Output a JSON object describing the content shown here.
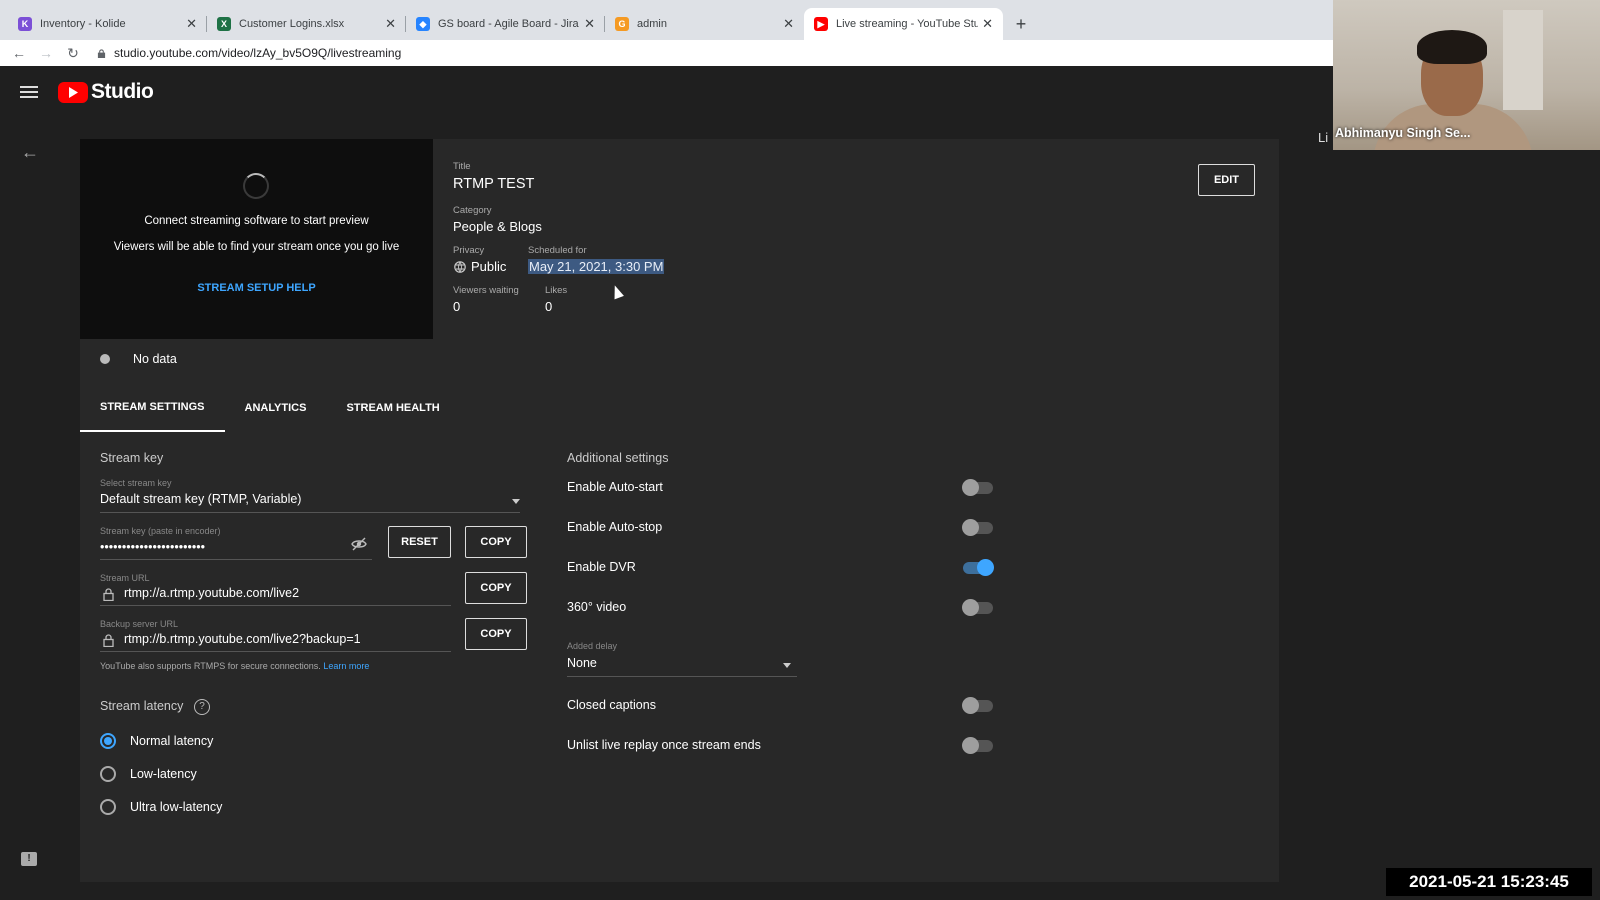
{
  "browser": {
    "tabs": [
      {
        "title": "Inventory - Kolide",
        "icon": "kolide-icon",
        "icon_color": "#7b4fd6",
        "glyph": "K"
      },
      {
        "title": "Customer Logins.xlsx",
        "icon": "excel-icon",
        "icon_color": "#1e7145",
        "glyph": "X"
      },
      {
        "title": "GS board - Agile Board - Jira",
        "icon": "jira-icon",
        "icon_color": "#2684ff",
        "glyph": "◆"
      },
      {
        "title": "admin",
        "icon": "grafana-icon",
        "icon_color": "#f59a23",
        "glyph": "G"
      },
      {
        "title": "Live streaming - YouTube Stud",
        "icon": "youtube-icon",
        "icon_color": "#ff0000",
        "glyph": "▶"
      }
    ],
    "url": "studio.youtube.com/video/lzAy_bv5O9Q/livestreaming"
  },
  "app": {
    "name": "Studio",
    "accent": "#3ea6ff",
    "brand_red": "#ff0000"
  },
  "preview": {
    "line1": "Connect streaming software to start preview",
    "line2": "Viewers will be able to find your stream once you go live",
    "help_link": "STREAM SETUP HELP"
  },
  "details": {
    "title_label": "Title",
    "title": "RTMP TEST",
    "category_label": "Category",
    "category": "People & Blogs",
    "privacy_label": "Privacy",
    "privacy": "Public",
    "scheduled_label": "Scheduled for",
    "scheduled": "May 21, 2021, 3:30 PM",
    "viewers_label": "Viewers waiting",
    "viewers": "0",
    "likes_label": "Likes",
    "likes": "0",
    "edit": "EDIT",
    "status": "No data"
  },
  "settings_tabs": [
    "STREAM SETTINGS",
    "ANALYTICS",
    "STREAM HEALTH"
  ],
  "stream": {
    "section": "Stream key",
    "select_label": "Select stream key",
    "select_value": "Default stream key (RTMP, Variable)",
    "key_label": "Stream key (paste in encoder)",
    "key_value": "••••••••••••••••••••••••",
    "reset": "RESET",
    "copy": "COPY",
    "url_label": "Stream URL",
    "url_value": "rtmp://a.rtmp.youtube.com/live2",
    "backup_label": "Backup server URL",
    "backup_value": "rtmp://b.rtmp.youtube.com/live2?backup=1",
    "note": "YouTube also supports RTMPS for secure connections.",
    "learn_more": "Learn more",
    "latency_title": "Stream latency",
    "latency_options": [
      "Normal latency",
      "Low-latency",
      "Ultra low-latency"
    ],
    "latency_selected": "Normal latency"
  },
  "additional": {
    "title": "Additional settings",
    "auto_start": "Enable Auto-start",
    "auto_stop": "Enable Auto-stop",
    "dvr": "Enable DVR",
    "video360": "360° video",
    "delay_label": "Added delay",
    "delay_value": "None",
    "captions": "Closed captions",
    "unlist": "Unlist live replay once stream ends"
  },
  "overlay": {
    "presenter": "Abhimanyu Singh Se...",
    "cut_text": "Li",
    "timestamp": "2021-05-21  15:23:45"
  }
}
